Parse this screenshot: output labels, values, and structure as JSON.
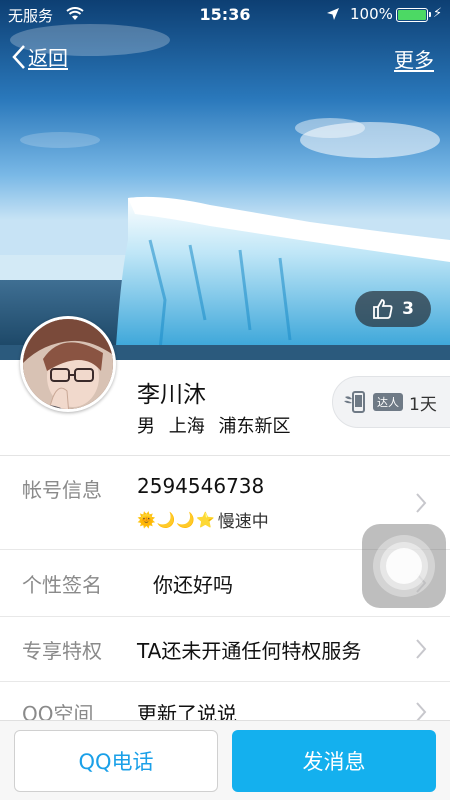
{
  "status_bar": {
    "carrier": "无服务",
    "time": "15:36",
    "battery": "100%"
  },
  "nav": {
    "back_label": "返回",
    "more_label": "更多"
  },
  "cover": {
    "like_count": "3"
  },
  "profile": {
    "name": "李川沐",
    "gender": "男",
    "city": "上海",
    "district": "浦东新区",
    "expert_badge": "达人",
    "expert_days": "1天"
  },
  "rows": {
    "account": {
      "label": "帐号信息",
      "qq_number": "2594546738",
      "level_icons": [
        "sun-icon",
        "moon-icon",
        "moon-icon",
        "star-icon"
      ],
      "speed": "慢速中"
    },
    "signature": {
      "label": "个性签名",
      "value": "你还好吗"
    },
    "privilege": {
      "label": "专享特权",
      "value": "TA还未开通任何特权服务"
    },
    "qzone": {
      "label": "QQ空间",
      "value": "更新了说说"
    }
  },
  "actions": {
    "call_label": "QQ电话",
    "message_label": "发消息"
  },
  "colors": {
    "accent": "#14b0ee",
    "call_text": "#1aa0e8",
    "battery": "#4cd964"
  }
}
